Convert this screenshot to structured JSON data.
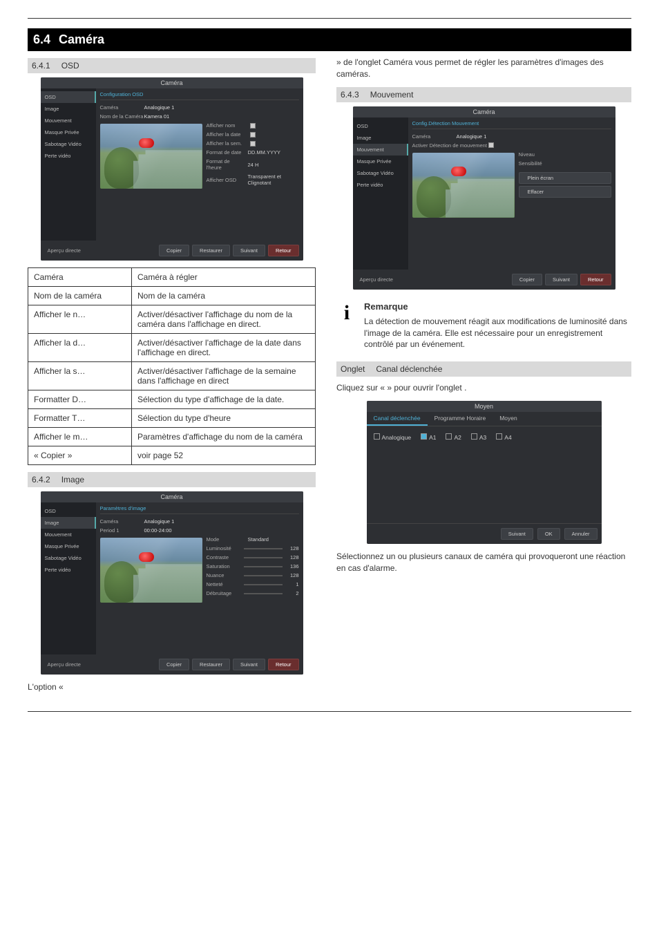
{
  "heading": {
    "num": "6.4",
    "text": "Caméra",
    "section_footer_prefix": "L'option «"
  },
  "left": {
    "sub1": {
      "a": "6.4.1",
      "b": "OSD"
    },
    "sub2": {
      "a": "6.4.2",
      "b": "Image"
    },
    "tail_image_text": " » de l'onglet Caméra vous permet de régler les paramètres d'images des caméras."
  },
  "right": {
    "sub3": {
      "a": "6.4.3",
      "b": "Mouvement"
    },
    "note_title": "Remarque",
    "note_body": "La détection de mouvement réagit aux modifications de luminosité dans l'image de la caméra. Elle est nécessaire pour un enregistrement contrôlé par un événement.",
    "sub4": {
      "a": "Onglet",
      "b": "Canal déclenchée"
    },
    "open_tab_pre": "Cliquez sur « ",
    "open_tab_mid": " » pour ouvrir l'onglet ",
    "open_tab_post": ".",
    "after_dialog_pre": "Sélectionnez un ou plusieurs canaux de caméra qui pro",
    "after_dialog_post": "voqueront une réaction en cas d'alarme."
  },
  "panel_common": {
    "title": "Caméra",
    "left_label": "Aperçu directe",
    "nav": [
      "OSD",
      "Image",
      "Mouvement",
      "Masque Privée",
      "Sabotage Vidéo",
      "Perte vidéo"
    ],
    "buttons": {
      "copy": "Copier",
      "restore": "Restaurer",
      "next": "Suivant",
      "back": "Retour",
      "clear": "Effacer",
      "fullscreen": "Plein écran",
      "ok": "OK",
      "cancel": "Annuler"
    }
  },
  "panel_osd": {
    "banner": "Configuration OSD",
    "camera_label": "Caméra",
    "camera_value": "Analogique 1",
    "name_label": "Nom de la Caméra",
    "name_value": "Kamera 01",
    "rows": [
      {
        "l": "Afficher nom",
        "chk": true
      },
      {
        "l": "Afficher la date",
        "chk": true
      },
      {
        "l": "Afficher la sem.",
        "chk": true
      },
      {
        "l": "Format de date",
        "v": "DD.MM.YYYY"
      },
      {
        "l": "Format de l'heure",
        "v": "24 H"
      },
      {
        "l": "Afficher OSD",
        "v": "Transparent et Clignotant"
      }
    ]
  },
  "panel_image": {
    "banner": "Paramètres d'image",
    "camera_label": "Caméra",
    "camera_value": "Analogique 1",
    "period_label": "Period 1",
    "period_value": "00:00-24:00",
    "mode_label": "Mode",
    "mode_value": "Standard",
    "sliders": [
      {
        "l": "Luminosité",
        "v": 128
      },
      {
        "l": "Contraste",
        "v": 128
      },
      {
        "l": "Saturation",
        "v": 136
      },
      {
        "l": "Nuance",
        "v": 128
      },
      {
        "l": "Netteté",
        "v": 1
      },
      {
        "l": "Débruitage",
        "v": 2
      }
    ]
  },
  "panel_motion": {
    "banner": "Config.Détection Mouvement",
    "camera_label": "Caméra",
    "camera_value": "Analogique 1",
    "enable_label": "Activer Détection de mouvement",
    "side": [
      {
        "l": "Niveau",
        "v": ""
      },
      {
        "l": "Sensibilité",
        "v": ""
      }
    ]
  },
  "tab_dialog": {
    "title": "Moyen",
    "tabs": [
      "Canal déclenchée",
      "Programme Horaire",
      "Moyen"
    ],
    "row_label": "Analogique",
    "channels": [
      {
        "id": "A1",
        "checked": true
      },
      {
        "id": "A2",
        "checked": false
      },
      {
        "id": "A3",
        "checked": false
      },
      {
        "id": "A4",
        "checked": false
      }
    ]
  },
  "params": [
    {
      "p": "Caméra",
      "d": "Caméra à régler"
    },
    {
      "p": "Nom de la caméra",
      "d": "Nom de la caméra"
    },
    {
      "p": "Afficher le n…",
      "d": "Activer/désactiver l'affichage du nom de la caméra dans l'affichage en direct."
    },
    {
      "p": "Afficher la d…",
      "d": "Activer/désactiver l'affichage de la date dans l'affichage en direct."
    },
    {
      "p": "Afficher la s…",
      "d": "Activer/désactiver l'affichage de la semaine dans l'affichage en direct"
    },
    {
      "p": "Formatter D…",
      "d": "Sélection du type d'affichage de la date."
    },
    {
      "p": "Formatter T…",
      "d": "Sélection du type d'heure"
    },
    {
      "p": "Afficher le m…",
      "d": "Paramètres d'affichage du nom de la caméra"
    },
    {
      "p": "« Copier »",
      "d": "voir page 52"
    }
  ]
}
